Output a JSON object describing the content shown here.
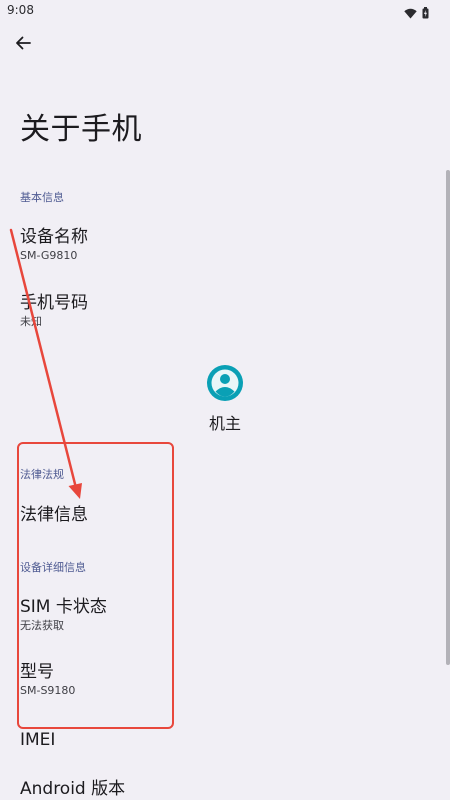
{
  "status_bar": {
    "time": "9:08",
    "icons": [
      "wifi-icon",
      "battery-icon"
    ]
  },
  "toolbar": {
    "back_icon": "arrow-back-icon"
  },
  "page_title": "关于手机",
  "sections": {
    "basic_info": {
      "header": "基本信息",
      "device_name": {
        "title": "设备名称",
        "summary": "SM-G9810"
      },
      "phone_number": {
        "title": "手机号码",
        "summary": "未知"
      }
    },
    "owner": {
      "icon": "account-circle-icon",
      "label": "机主"
    },
    "legal": {
      "header": "法律法规",
      "legal_info": {
        "title": "法律信息"
      }
    },
    "device_details": {
      "header": "设备详细信息",
      "sim_status": {
        "title": "SIM 卡状态",
        "summary": "无法获取"
      },
      "model": {
        "title": "型号",
        "summary": "SM-S9180"
      },
      "imei": {
        "title": "IMEI"
      },
      "android_version": {
        "title": "Android 版本"
      }
    }
  },
  "colors": {
    "background": "#f1eff5",
    "section_header": "#4f5b92",
    "accent": "#0aa0b5",
    "annotation": "#e8473c"
  }
}
